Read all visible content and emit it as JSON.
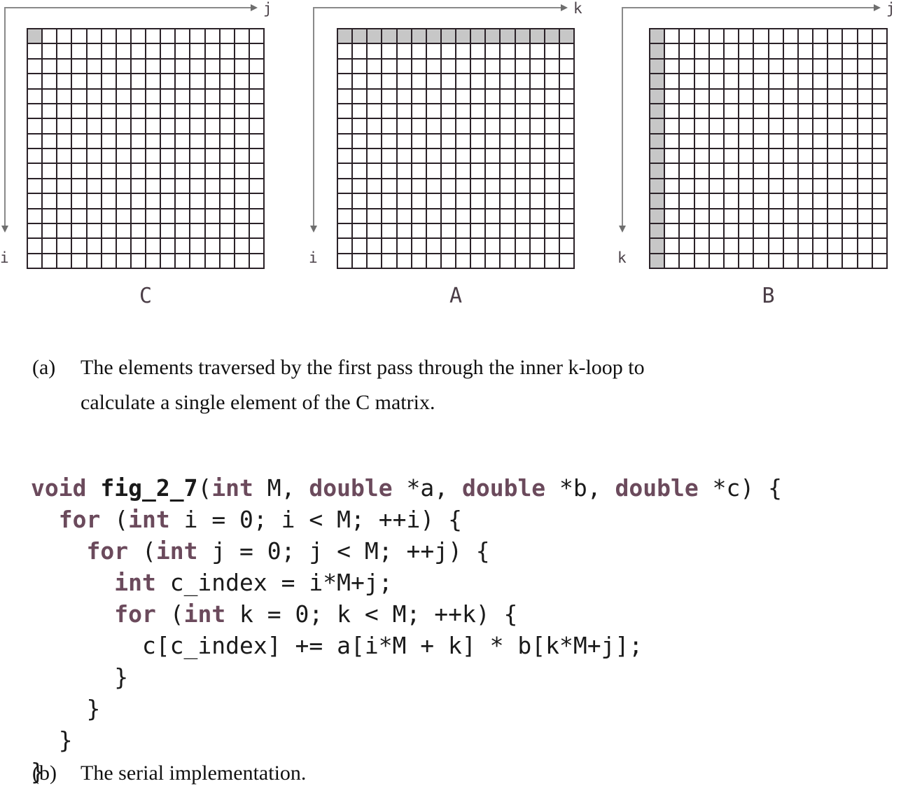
{
  "figure": {
    "matrices": [
      {
        "name": "C",
        "rows": 16,
        "cols": 16,
        "col_axis_label": "j",
        "row_axis_label": "i",
        "highlight": "single-cell",
        "highlight_desc": "top-left element (row 0, column 0)"
      },
      {
        "name": "A",
        "rows": 16,
        "cols": 16,
        "col_axis_label": "k",
        "row_axis_label": "i",
        "highlight": "first-row",
        "highlight_desc": "entire first row (row 0)"
      },
      {
        "name": "B",
        "rows": 16,
        "cols": 16,
        "col_axis_label": "j",
        "row_axis_label": "k",
        "highlight": "first-column",
        "highlight_desc": "entire first column (column 0)"
      }
    ],
    "colors": {
      "grid_line": "#2b2228",
      "cell_fill": "#ffffff",
      "cell_highlight": "#c7c7c7",
      "axis_arrow": "#8a8a8a",
      "matrix_label": "#4a3d46",
      "keyword": "#6b4a5c",
      "code_text": "#1a1a1a"
    }
  },
  "caption_a": {
    "tag": "(a)",
    "line1": "The elements traversed by the first pass through the inner k-loop to",
    "line2": "calculate a single element of the C matrix."
  },
  "caption_b": {
    "tag": "(b)",
    "text": "The serial implementation."
  },
  "code": {
    "language": "C",
    "function_name": "fig_2_7",
    "lines": [
      "void fig_2_7(int M, double *a, double *b, double *c) {",
      "  for (int i = 0; i < M; ++i) {",
      "    for (int j = 0; j < M; ++j) {",
      "      int c_index = i*M+j;",
      "      for (int k = 0; k < M; ++k) {",
      "        c[c_index] += a[i*M + k] * b[k*M+j];",
      "      }",
      "    }",
      "  }",
      "}"
    ],
    "tokens": [
      [
        [
          "kw",
          "void"
        ],
        [
          "pl",
          " "
        ],
        [
          "fn",
          "fig_2_7"
        ],
        [
          "pl",
          "("
        ],
        [
          "kw",
          "int"
        ],
        [
          "pl",
          " M, "
        ],
        [
          "kw",
          "double"
        ],
        [
          "pl",
          " *a, "
        ],
        [
          "kw",
          "double"
        ],
        [
          "pl",
          " *b, "
        ],
        [
          "kw",
          "double"
        ],
        [
          "pl",
          " *c) {"
        ]
      ],
      [
        [
          "pl",
          "  "
        ],
        [
          "kw",
          "for"
        ],
        [
          "pl",
          " ("
        ],
        [
          "kw",
          "int"
        ],
        [
          "pl",
          " i = 0; i < M; ++i) {"
        ]
      ],
      [
        [
          "pl",
          "    "
        ],
        [
          "kw",
          "for"
        ],
        [
          "pl",
          " ("
        ],
        [
          "kw",
          "int"
        ],
        [
          "pl",
          " j = 0; j < M; ++j) {"
        ]
      ],
      [
        [
          "pl",
          "      "
        ],
        [
          "kw",
          "int"
        ],
        [
          "pl",
          " c_index = i*M+j;"
        ]
      ],
      [
        [
          "pl",
          "      "
        ],
        [
          "kw",
          "for"
        ],
        [
          "pl",
          " ("
        ],
        [
          "kw",
          "int"
        ],
        [
          "pl",
          " k = 0; k < M; ++k) {"
        ]
      ],
      [
        [
          "pl",
          "        c[c_index] += a[i*M + k] * b[k*M+j];"
        ]
      ],
      [
        [
          "pl",
          "      }"
        ]
      ],
      [
        [
          "pl",
          "    }"
        ]
      ],
      [
        [
          "pl",
          "  }"
        ]
      ],
      [
        [
          "pl",
          "}"
        ]
      ]
    ]
  }
}
